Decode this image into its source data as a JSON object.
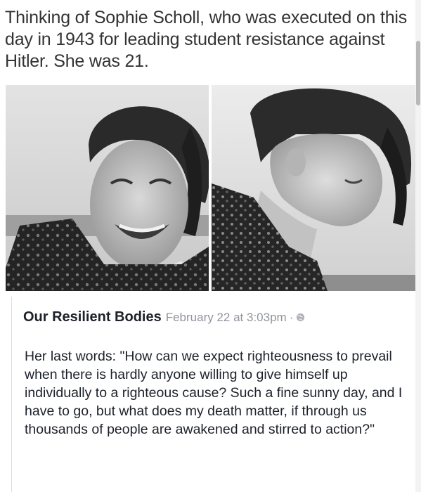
{
  "caption": {
    "text": "Thinking of Sophie Scholl, who was executed on this day in 1943 for leading student resistance against Hitler. She was 21."
  },
  "post": {
    "author": "Our Resilient Bodies",
    "timestamp": "February 22 at 3:03pm",
    "separator": "·",
    "privacy_icon": "globe-icon",
    "body": "Her last words: \"How can we expect righteousness to prevail when there is hardly anyone willing to give himself up individually to a righteous cause? Such a fine sunny day, and I have to go, but what does my death matter, if through us thousands of people are awakened and stirred to action?\""
  },
  "colors": {
    "caption_text": "#333333",
    "author_text": "#1d2129",
    "meta_text": "#90949c",
    "card_border": "#dcdcdc"
  }
}
